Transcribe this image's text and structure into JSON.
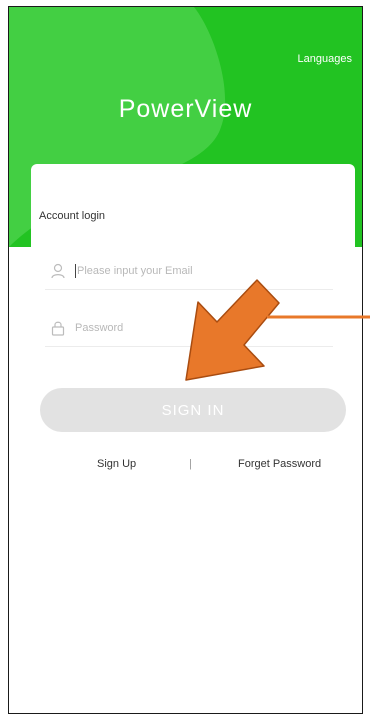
{
  "header": {
    "languages_label": "Languages",
    "app_name": "PowerView"
  },
  "login": {
    "heading": "Account login",
    "email_placeholder": "Please input your Email",
    "password_placeholder": "Password",
    "signin_label": "SIGN IN",
    "signup_label": "Sign Up",
    "divider": "|",
    "forgot_label": "Forget Password"
  },
  "icons": {
    "email_field": "user-icon",
    "password_field": "lock-icon",
    "annotation": "arrow-pointer-icon"
  },
  "colors": {
    "brand_green": "#22c322",
    "button_disabled": "#e2e2e2",
    "annotation_arrow": "#e8782a"
  }
}
